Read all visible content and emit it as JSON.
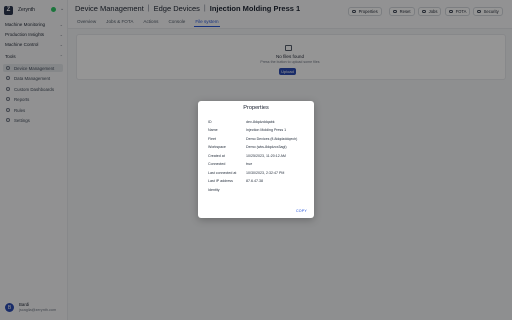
{
  "app": {
    "name": "Zerynth",
    "logo_letter": "Z"
  },
  "sidebar": {
    "groups": [
      {
        "label": "Machine Monitoring"
      },
      {
        "label": "Production Insights"
      },
      {
        "label": "Machine Control"
      }
    ],
    "section_label": "Tools",
    "items": [
      {
        "label": "Device Management",
        "active": true
      },
      {
        "label": "Data Management"
      },
      {
        "label": "Custom Dashboards"
      },
      {
        "label": "Reports"
      },
      {
        "label": "Rules"
      },
      {
        "label": "Settings"
      }
    ],
    "user": {
      "initial": "B",
      "name": "Bardi",
      "email": "jscaglia@zerynth.com"
    }
  },
  "header": {
    "breadcrumbs": [
      "Device Management",
      "Edge Devices",
      "Injection Molding Press 1"
    ],
    "separator": "|",
    "tabs": [
      {
        "label": "Overview"
      },
      {
        "label": "Jobs & FOTA"
      },
      {
        "label": "Actions"
      },
      {
        "label": "Console"
      },
      {
        "label": "File system",
        "active": true
      }
    ],
    "buttons": [
      {
        "label": "Properties",
        "icon": "info-icon"
      },
      {
        "label": "Reset",
        "icon": "reset-icon"
      },
      {
        "label": "Jobs",
        "icon": "jobs-icon"
      },
      {
        "label": "FOTA",
        "icon": "upload-icon"
      },
      {
        "label": "Security",
        "icon": "lock-icon"
      }
    ]
  },
  "filesystem": {
    "empty_title": "No files found",
    "empty_hint": "Press the button to upload some files",
    "upload_label": "Upload"
  },
  "dialog": {
    "title": "Properties",
    "rows": [
      {
        "label": "ID",
        "value": "dev-8dqdzddqabk"
      },
      {
        "label": "Name",
        "value": "Injection Molding Press 1"
      },
      {
        "label": "Fleet",
        "value": "Demo Devices (fl-8dqdzddqech)"
      },
      {
        "label": "Workspace",
        "value": "Demo (wks-8dqdzcx3agi)"
      },
      {
        "label": "Created at",
        "value": "10/25/2023, 11:20:12 AM"
      },
      {
        "label": "Connected",
        "value": "true"
      },
      {
        "label": "Last connected at",
        "value": "10/30/2023, 2:32:47 PM"
      },
      {
        "label": "Last IP address",
        "value": "87.6.47.38"
      },
      {
        "label": "Identity",
        "value": ""
      }
    ],
    "copy_label": "COPY"
  }
}
